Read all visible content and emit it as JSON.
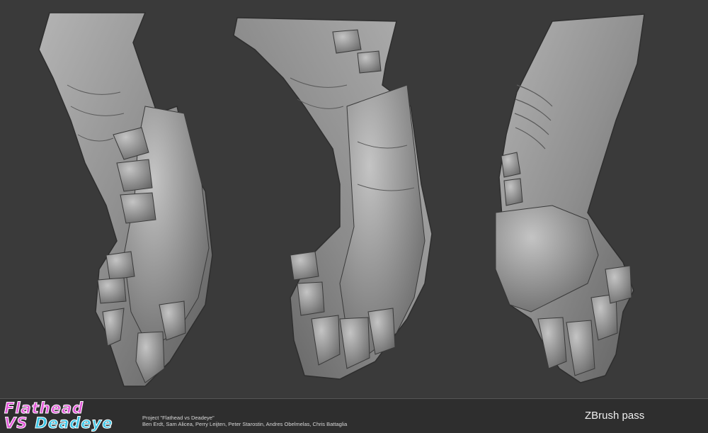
{
  "image": {
    "subject": "three views of a sculpted creature arm and hand",
    "background_color": "#3a3a3a"
  },
  "footer": {
    "logo": {
      "line1": "Flathead",
      "line2_a": "VS",
      "line2_b": "Deadeye",
      "colors": {
        "pink": "#e257d8",
        "cyan": "#3cc6e6",
        "outline": "#ffffff"
      }
    },
    "project": "Project \"Flathead vs Deadeye\"",
    "names": "Ben Erdt, Sam Alicea, Perry Leijten, Peter Starostin, Andres Obelmelas, Chris Battaglia",
    "pass_label": "ZBrush pass"
  }
}
